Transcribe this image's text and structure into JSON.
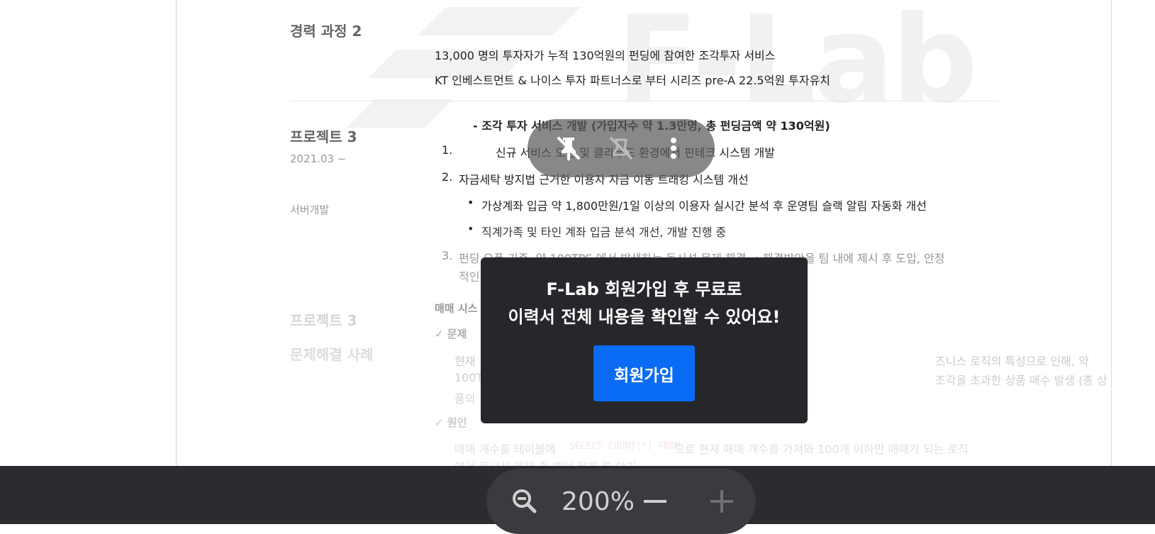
{
  "resume": {
    "career2": {
      "title": "경력 과정 2",
      "line1": "13,000 명의 투자자가 누적 130억원의 펀딩에 참여한 조각투자 서비스",
      "line2": "KT 인베스트먼트 & 나이스 투자 파트너스로 부터 시리즈 pre-A 22.5억원 투자유치"
    },
    "project3": {
      "title": "프로젝트 3",
      "date": "2021.03 ~",
      "role": "서버개발",
      "heading": "- 조각 투자 서비스 개발 (가입자수 약 1.3만명, 총 펀딩금액 약 130억원)",
      "item1_num": "1.",
      "item1": "신규 서비스 오픈 및 클라우드 환경에서 핀테크 시스템 개발",
      "item2_num": "2.",
      "item2": "자금세탁 방지법 근거한 이용자 자금 이동 트래킹 시스템 개선",
      "bullet1": "가상계좌 입금 약 1,800만원/1일 이상의 이용자 실시간 분석 후 운영팀 슬랙 알림 자동화 개선",
      "bullet2": "직계가족 및 타인 계좌 입금 분석 개선, 개발 진행 중",
      "item3_num": "3.",
      "item3": "펀딩 오픈 기준, 약 100TPS 에서 발생하는 동시성 문제 해결 → 해결방안을 팀 내에 제시 후 도입, 안정",
      "item3_cont": "적인"
    },
    "case": {
      "title1": "프로젝트 3",
      "title2": "문제해결 사례",
      "subject": "매매 시스",
      "problem_label": "✓ 문제",
      "problem_line1_a": "현재",
      "problem_line1_b": "즈니스 로직의 특성으로 인해, 약",
      "problem_line2_a": "100T",
      "problem_line2_b": "조각을 초과한 상품 매수 발생 (총 상",
      "problem_line3": "품의",
      "cause_label": "✓ 원인",
      "cause_line1_a": "매매 개수를 테이블에",
      "cause_code": "SELECT COUNT(*) FROM",
      "cause_line1_b": "으로 현재 매매 개수를 가져와 100개 이하만 매매가 되는 로직",
      "cause_line2": "에서 동시성 문제 즉 패턴 문제 를 야기"
    }
  },
  "watermark": {
    "text": "F-Lab"
  },
  "modal": {
    "line1": "F-Lab 회원가입 후 무료로",
    "line2": "이력서 전체 내용을 확인할 수 있어요!",
    "button": "회원가입"
  },
  "zoom": {
    "value": "200%"
  },
  "icons": {
    "pin": "unpin-icon",
    "mute": "notifications-off-icon",
    "more": "more-vert-icon",
    "zoom_out": "zoom-out-icon",
    "minus": "minus-icon",
    "plus": "plus-icon"
  },
  "colors": {
    "accent": "#0a6cf5",
    "modal_bg": "#25272b",
    "toolbar_bg": "#2b2c2f"
  }
}
